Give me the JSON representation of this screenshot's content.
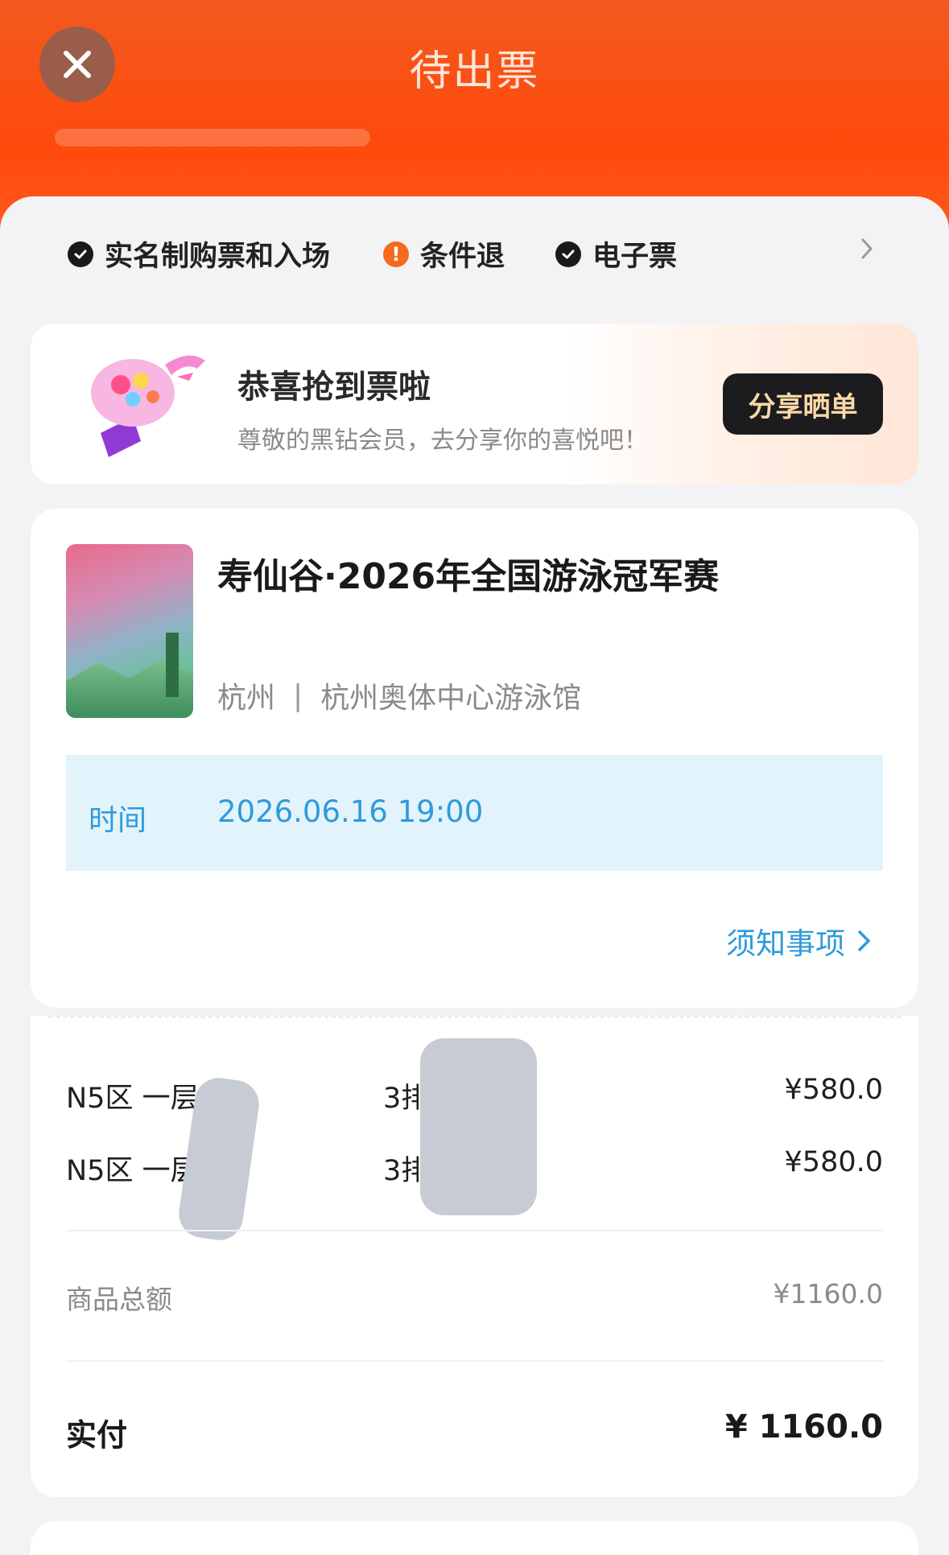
{
  "header": {
    "title": "待出票",
    "close_icon": "close-icon"
  },
  "tags": [
    {
      "label": "实名制购票和入场",
      "icon": "check-circle-icon"
    },
    {
      "label": "条件退",
      "icon": "warning-circle-icon"
    },
    {
      "label": "电子票",
      "icon": "check-circle-icon"
    }
  ],
  "promo": {
    "title": "恭喜抢到票啦",
    "subtitle": "尊敬的黑钻会员，去分享你的喜悦吧！",
    "button": "分享晒单",
    "art_icon": "celebration-torch-icon"
  },
  "event": {
    "name": "寿仙谷·2026年全国游泳冠军赛",
    "city": "杭州",
    "separator": "|",
    "venue": "杭州奥体中心游泳馆",
    "time_label": "时间",
    "time_value": "2026.06.16 19:00",
    "notice_link": "须知事项"
  },
  "tickets": [
    {
      "area": "N5区 一层",
      "row": "3排",
      "price": "¥580.0"
    },
    {
      "area": "N5区 一层",
      "row": "3排",
      "price": "¥580.0"
    }
  ],
  "summary": {
    "subtotal_label": "商品总额",
    "subtotal_value": "¥1160.0",
    "paid_label": "实付",
    "paid_value": "¥ 1160.0"
  },
  "colors": {
    "header": "#ff4a0c",
    "accent_blue": "#2f9bd9",
    "time_bg": "#e3f3fc",
    "warn": "#f56a1d",
    "share_btn_bg": "#1c1c1e",
    "share_btn_text": "#ffd8a8"
  }
}
